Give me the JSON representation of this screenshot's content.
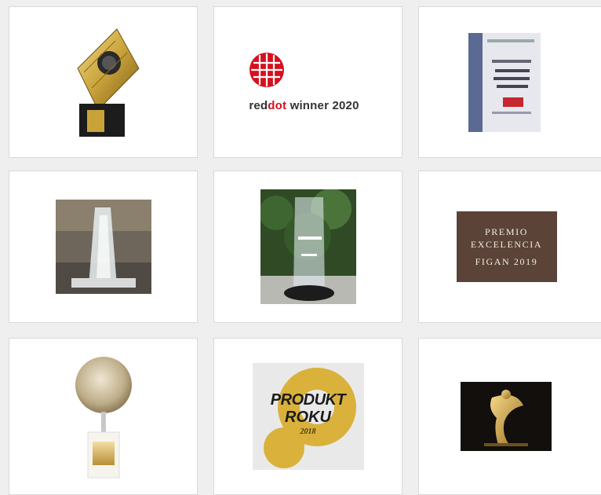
{
  "awards": [
    {
      "name": "award-gold-trophy",
      "kind": "image"
    },
    {
      "name": "award-reddot",
      "kind": "text",
      "text_prefix": "red",
      "text_accent": "dot",
      "text_suffix": " winner 2020",
      "accent_color": "#d6101f"
    },
    {
      "name": "award-certificate",
      "kind": "image"
    },
    {
      "name": "award-glass-trophy-industrial",
      "kind": "image"
    },
    {
      "name": "award-glass-trophy-trees",
      "kind": "image"
    },
    {
      "name": "award-premio",
      "kind": "text",
      "line1": "PREMIO",
      "line2": "EXCELENCIA",
      "line3": "FIGAN 2019",
      "bg_color": "#5b4338"
    },
    {
      "name": "award-globe-trophy",
      "kind": "image"
    },
    {
      "name": "award-produkt-roku",
      "kind": "text",
      "line1": "PRODUKT",
      "line2": "ROKU",
      "year": "2018"
    },
    {
      "name": "award-gold-figure",
      "kind": "image"
    }
  ]
}
